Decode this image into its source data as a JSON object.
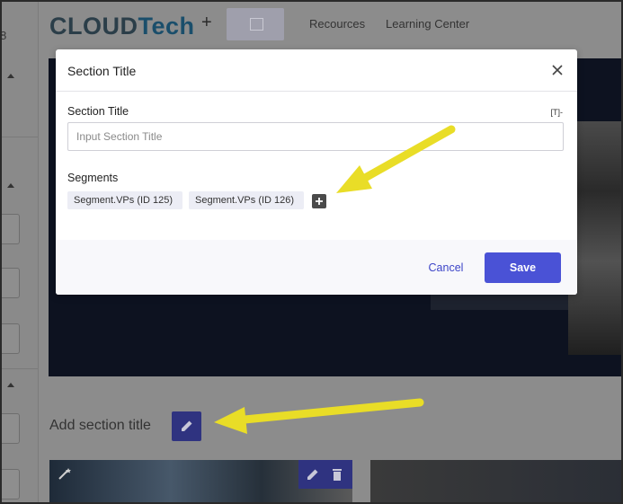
{
  "header": {
    "logo_part1": "CLOUD",
    "logo_part2": "Tech",
    "plus": "+",
    "nav": [
      "Recources",
      "Learning Center"
    ]
  },
  "left_rail": {
    "number": "8"
  },
  "page": {
    "add_section_title": "Add section title"
  },
  "modal": {
    "title": "Section Title",
    "section_title_label": "Section Title",
    "text_toggle": "[T]-",
    "input_placeholder": "Input Section Title",
    "input_value": "",
    "segments_label": "Segments",
    "segments": [
      "Segment.VPs (ID 125)",
      "Segment.VPs (ID 126)"
    ],
    "cancel_label": "Cancel",
    "save_label": "Save"
  },
  "colors": {
    "accent": "#4a52d6",
    "annotation_arrow": "#e9dd27",
    "overlay_dim": "#8c8c8c"
  },
  "icons": [
    "image-placeholder-icon",
    "close-icon",
    "plus-icon",
    "pencil-icon",
    "trash-icon",
    "magic-wand-icon",
    "caret-up-icon"
  ]
}
